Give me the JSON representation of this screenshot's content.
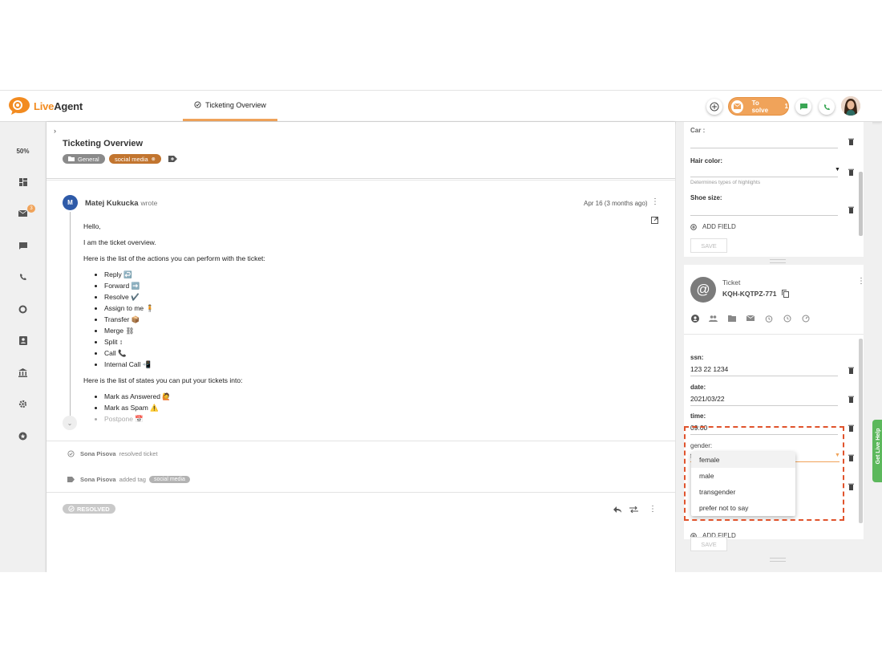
{
  "app": {
    "name_part1": "Live",
    "name_part2": "Agent"
  },
  "header": {
    "tab_label": "Ticketing Overview",
    "to_solve_label": "To solve",
    "to_solve_count": "1"
  },
  "sidebar": {
    "zoom": "50%",
    "mail_badge": "3"
  },
  "ticket": {
    "title": "Ticketing Overview",
    "tags": [
      "General",
      "social media"
    ]
  },
  "message": {
    "avatar_initial": "M",
    "author": "Matej Kukucka",
    "wrote": "wrote",
    "date": "Apr 16 (3 months ago)",
    "greeting": "Hello,",
    "intro": "I am the ticket overview.",
    "actions_intro": "Here is the list of the actions you can perform with the ticket:",
    "actions": [
      "Reply ↩️",
      "Forward ➡️",
      "Resolve ✔️",
      "Assign to me 🧍",
      "Transfer 📦",
      "Merge ⛓",
      "Split ↕",
      "Call 📞",
      "Internal Call 📲"
    ],
    "states_intro": "Here is the list of states you can put your tickets into:",
    "states": [
      "Mark as Answered 🙋",
      "Mark as Spam ⚠️",
      "Postpone 📅"
    ]
  },
  "events": [
    {
      "user": "Sona Pisova",
      "action": "resolved ticket",
      "tag": ""
    },
    {
      "user": "Sona Pisova",
      "action": "added tag",
      "tag": "social media"
    }
  ],
  "status": "RESOLVED",
  "contact_fields": {
    "car_label": "Car :",
    "hair_label": "Hair color:",
    "hair_hint": "Determines types of highlights",
    "shoe_label": "Shoe size:",
    "add_field": "ADD FIELD",
    "save": "SAVE"
  },
  "ticket_panel": {
    "icon": "@",
    "label": "Ticket",
    "code": "KQH-KQTPZ-771",
    "fields": [
      {
        "label": "ssn:",
        "value": "123 22 1234"
      },
      {
        "label": "date:",
        "value": "2021/03/22"
      },
      {
        "label": "time:",
        "value": "09:00"
      },
      {
        "label": "gender:",
        "value": "female"
      }
    ],
    "add_field": "ADD FIELD",
    "save": "SAVE"
  },
  "gender_dropdown": {
    "options": [
      "female",
      "male",
      "transgender",
      "prefer not to say"
    ],
    "selected": "female"
  },
  "live_help": "Get Live Help",
  "colors": {
    "accent": "#f0a35a",
    "social_tag": "#c2752f",
    "highlight_box": "#e0532c",
    "live_help": "#5cb85c"
  }
}
